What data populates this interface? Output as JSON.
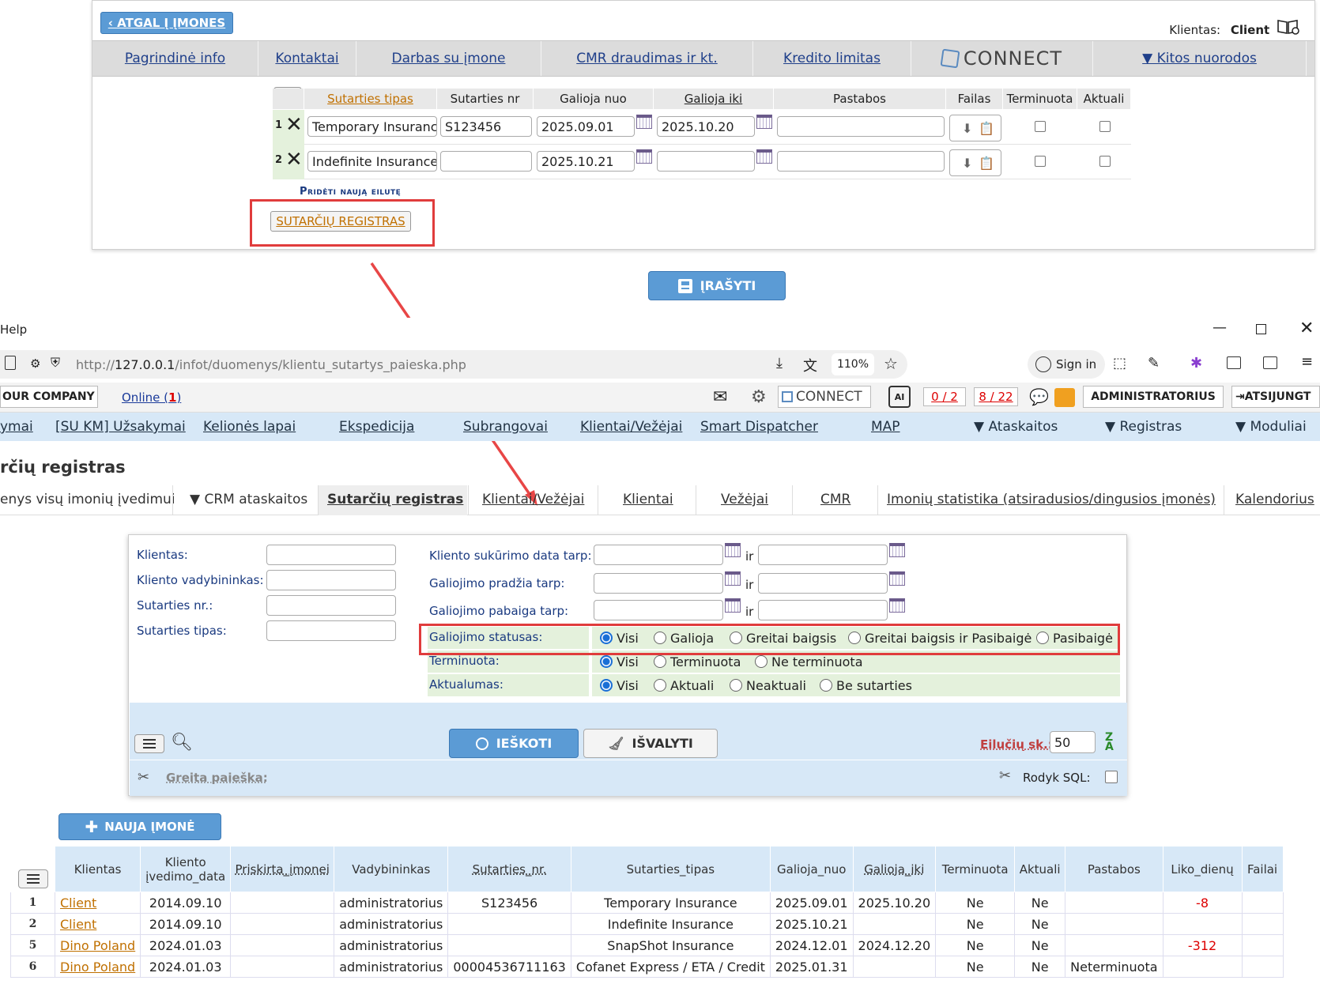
{
  "top": {
    "back_label": "‹ ATGAL Į ĮMONES",
    "client_label": "Klientas:",
    "client_value": "Client",
    "tabs": [
      "Pagrindinė info",
      "Kontaktai",
      "Darbas su įmone",
      "CMR draudimas ir kt.",
      "Kredito limitas",
      "CONNECT",
      "▼ Kitos nuorodos"
    ],
    "grid_headers": [
      "Sutarties tipas",
      "Sutarties nr",
      "Galioja nuo",
      "Galioja iki",
      "Pastabos",
      "Failas",
      "Terminuota",
      "Aktuali"
    ],
    "rows": [
      {
        "num": "1",
        "tipas": "Temporary Insurance",
        "nr": "S123456",
        "nuo": "2025.09.01",
        "iki": "2025.10.20",
        "pastabos": ""
      },
      {
        "num": "2",
        "tipas": "Indefinite Insurance",
        "nr": "",
        "nuo": "2025.10.21",
        "iki": "",
        "pastabos": ""
      }
    ],
    "add_row": "Pridėti naują eilutę",
    "registras_btn": "SUTARČIŲ REGISTRAS",
    "save_btn": "ĮRAŠYTI"
  },
  "browser": {
    "title_fragment": "Help",
    "url_prefix": "http://",
    "url_host": "127.0.0.1",
    "url_path": "/infot/duomenys/klientu_sutartys_paieska.php",
    "zoom": "110%",
    "sign_in": "Sign in"
  },
  "site": {
    "company": "OUR COMPANY",
    "online_label": "Online (",
    "online_count": "1",
    "online_close": ")",
    "connect": "CONNECT",
    "counter1": "0 / 2",
    "counter2": "8 / 22",
    "admin": "ADMINISTRATORIUS",
    "logout": "ATSIJUNGT"
  },
  "nav": [
    "ymai",
    "[SU KM] Užsakymai",
    "Kelionės lapai",
    "Ekspedicija",
    "Subrangovai",
    "Klientai/Vežėjai",
    "Smart Dispatcher",
    "MAP",
    "▼ Ataskaitos",
    "▼ Registras",
    "▼ Moduliai"
  ],
  "page_title": "rčių registras",
  "subtabs": [
    "enys visų imonių įvedimui",
    "▼ CRM ataskaitos",
    "Sutarčių registras",
    "Klientai/Vežėjai",
    "Klientai",
    "Vežėjai",
    "CMR",
    "Imonių statistika (atsiradusios/dingusios įmonės)",
    "Kalendorius"
  ],
  "filters": {
    "klientas": "Klientas:",
    "vadybininkas": "Kliento vadybininkas:",
    "sutarties_nr": "Sutarties nr.:",
    "sutarties_tipas": "Sutarties tipas:",
    "sukurimo": "Kliento sukūrimo data tarp:",
    "pradzia": "Galiojimo pradžia tarp:",
    "pabaiga": "Galiojimo pabaiga tarp:",
    "ir": "ir",
    "statusas": "Galiojimo statusas:",
    "statusas_opts": [
      "Visi",
      "Galioja",
      "Greitai baigsis",
      "Greitai baigsis ir Pasibaigė",
      "Pasibaigė"
    ],
    "terminuota": "Terminuota:",
    "terminuota_opts": [
      "Visi",
      "Terminuota",
      "Ne terminuota"
    ],
    "aktualumas": "Aktualumas:",
    "aktualumas_opts": [
      "Visi",
      "Aktuali",
      "Neaktuali",
      "Be sutarties"
    ],
    "search_btn": "IEŠKOTI",
    "clear_btn": "IŠVALYTI",
    "rows_label": "Eilučių sk.:",
    "rows_value": "50",
    "quick_search": "Greita paieška:",
    "show_sql": "Rodyk SQL:"
  },
  "new_company_btn": "NAUJA ĮMONĖ",
  "table": {
    "headers": [
      "Klientas",
      "Kliento įvedimo_data",
      "Priskirta_įmonei",
      "Vadybininkas",
      "Sutarties_nr.",
      "Sutarties_tipas",
      "Galioja_nuo",
      "Galioja_iki",
      "Terminuota",
      "Aktuali",
      "Pastabos",
      "Liko_dienų",
      "Failai"
    ],
    "rows": [
      {
        "num": "1",
        "klientas": "Client",
        "data": "2014.09.10",
        "imonei": "",
        "vad": "administratorius",
        "nr": "S123456",
        "tipas": "Temporary Insurance",
        "nuo": "2025.09.01",
        "iki": "2025.10.20",
        "term": "Ne",
        "akt": "Ne",
        "past": "",
        "liko": "-8",
        "failai": ""
      },
      {
        "num": "2",
        "klientas": "Client",
        "data": "2014.09.10",
        "imonei": "",
        "vad": "administratorius",
        "nr": "",
        "tipas": "Indefinite Insurance",
        "nuo": "2025.10.21",
        "iki": "",
        "term": "Ne",
        "akt": "Ne",
        "past": "",
        "liko": "",
        "failai": ""
      },
      {
        "num": "5",
        "klientas": "Dino Poland",
        "data": "2024.01.03",
        "imonei": "",
        "vad": "administratorius",
        "nr": "",
        "tipas": "SnapShot Insurance",
        "nuo": "2024.12.01",
        "iki": "2024.12.20",
        "term": "Ne",
        "akt": "Ne",
        "past": "",
        "liko": "-312",
        "failai": ""
      },
      {
        "num": "6",
        "klientas": "Dino Poland",
        "data": "2024.01.03",
        "imonei": "",
        "vad": "administratorius",
        "nr": "00004536711163",
        "tipas": "Cofanet Express / ETA / Credit",
        "nuo": "2025.01.31",
        "iki": "",
        "term": "Ne",
        "akt": "Ne",
        "past": "Neterminuota",
        "liko": "",
        "failai": ""
      }
    ]
  }
}
